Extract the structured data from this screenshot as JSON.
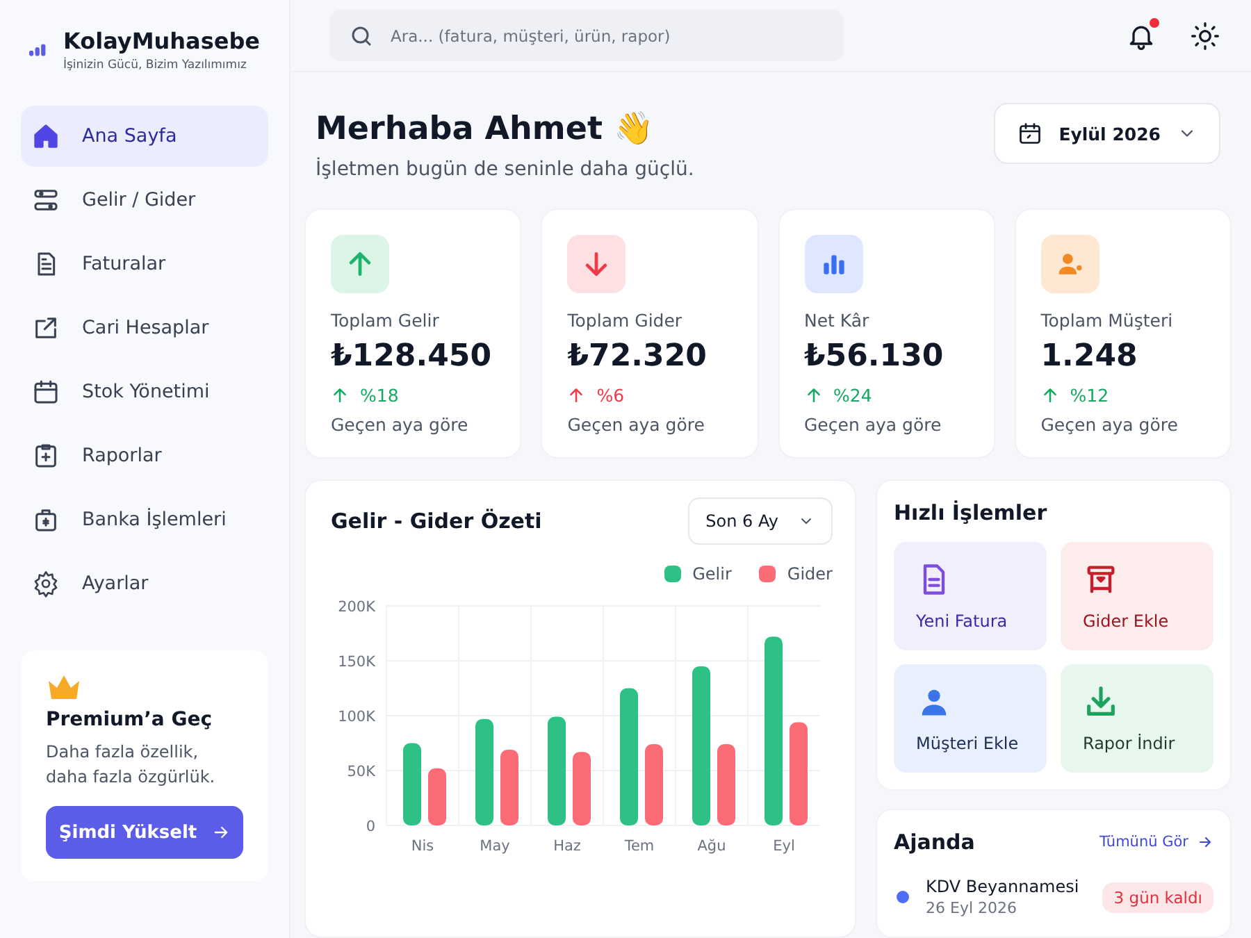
{
  "brand": {
    "name": "KolayMuhasebe",
    "tagline": "İşinizin Gücü, Bizim Yazılımımız"
  },
  "sidebar": {
    "items": [
      {
        "label": "Ana Sayfa",
        "kind": "home",
        "selected": true
      },
      {
        "label": "Gelir / Gider",
        "kind": "sliders",
        "selected": false
      },
      {
        "label": "Faturalar",
        "kind": "document",
        "selected": false
      },
      {
        "label": "Cari Hesaplar",
        "kind": "share",
        "selected": false
      },
      {
        "label": "Stok Yönetimi",
        "kind": "calendar",
        "selected": false
      },
      {
        "label": "Raporlar",
        "kind": "clipboard",
        "selected": false
      },
      {
        "label": "Banka İşlemleri",
        "kind": "bank",
        "selected": false
      },
      {
        "label": "Ayarlar",
        "kind": "gear",
        "selected": false
      }
    ]
  },
  "premium": {
    "title": "Premium’a Geç",
    "text": "Daha fazla özellik,\ndaha fazla özgürlük.",
    "button": "Şimdi Yükselt"
  },
  "header": {
    "search": {
      "placeholder": "Ara... (fatura, müşteri, ürün, rapor)"
    },
    "notifications_unread": true
  },
  "greeting": {
    "title": "Merhaba Ahmet 👋",
    "subtitle": "İşletmen bugün de seninle daha güçlü.",
    "period": "Eylül 2026"
  },
  "stats": [
    {
      "kind": "income",
      "label": "Toplam Gelir",
      "value": "₺128.450",
      "change": "%18",
      "color": "#17a862",
      "note": "Geçen aya göre"
    },
    {
      "kind": "expense",
      "label": "Toplam Gider",
      "value": "₺72.320",
      "change": "%6",
      "color": "#ef3b48",
      "note": "Geçen aya göre"
    },
    {
      "kind": "profit",
      "label": "Net Kâr",
      "value": "₺56.130",
      "change": "%24",
      "color": "#17a862",
      "note": "Geçen aya göre"
    },
    {
      "kind": "customers",
      "label": "Toplam Müşteri",
      "value": "1.248",
      "change": "%12",
      "color": "#17a862",
      "note": "Geçen aya göre"
    }
  ],
  "summary": {
    "title": "Gelir - Gider Özeti",
    "range": "Son 6 Ay",
    "chart_data": {
      "type": "bar",
      "categories": [
        "Nis",
        "May",
        "Haz",
        "Tem",
        "Ağu",
        "Eyl"
      ],
      "series": [
        {
          "name": "Gelir",
          "color": "#2ec185",
          "values": [
            75000,
            97000,
            99000,
            125000,
            145000,
            172000
          ]
        },
        {
          "name": "Gider",
          "color": "#fb6b76",
          "values": [
            52000,
            69000,
            67000,
            74000,
            74000,
            94000
          ]
        }
      ],
      "grid": true,
      "ylim": [
        0,
        200000
      ],
      "yticks": [
        {
          "value": 0,
          "label": "0"
        },
        {
          "value": 50000,
          "label": "50K"
        },
        {
          "value": 100000,
          "label": "100K"
        },
        {
          "value": 150000,
          "label": "150K"
        },
        {
          "value": 200000,
          "label": "200K"
        }
      ]
    }
  },
  "quick_actions": {
    "title": "Hızlı İşlemler",
    "items": [
      {
        "kind": "invoice",
        "label": "Yeni Fatura"
      },
      {
        "kind": "expense",
        "label": "Gider Ekle"
      },
      {
        "kind": "customer",
        "label": "Müşteri Ekle"
      },
      {
        "kind": "download",
        "label": "Rapor İndir"
      }
    ]
  },
  "agenda": {
    "title": "Ajanda",
    "link": "Tümünü Gör",
    "items": [
      {
        "title": "KDV Beyannamesi",
        "date": "26 Eyl 2026",
        "badge": "3 gün kaldı",
        "color": "#4f6ef7"
      }
    ]
  }
}
